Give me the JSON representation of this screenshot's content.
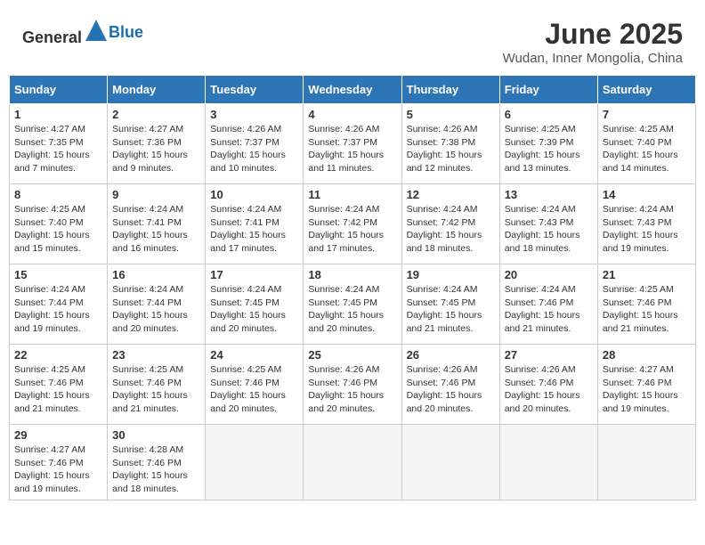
{
  "header": {
    "logo_general": "General",
    "logo_blue": "Blue",
    "month": "June 2025",
    "location": "Wudan, Inner Mongolia, China"
  },
  "days_of_week": [
    "Sunday",
    "Monday",
    "Tuesday",
    "Wednesday",
    "Thursday",
    "Friday",
    "Saturday"
  ],
  "weeks": [
    [
      {
        "day": "1",
        "info": "Sunrise: 4:27 AM\nSunset: 7:35 PM\nDaylight: 15 hours\nand 7 minutes."
      },
      {
        "day": "2",
        "info": "Sunrise: 4:27 AM\nSunset: 7:36 PM\nDaylight: 15 hours\nand 9 minutes."
      },
      {
        "day": "3",
        "info": "Sunrise: 4:26 AM\nSunset: 7:37 PM\nDaylight: 15 hours\nand 10 minutes."
      },
      {
        "day": "4",
        "info": "Sunrise: 4:26 AM\nSunset: 7:37 PM\nDaylight: 15 hours\nand 11 minutes."
      },
      {
        "day": "5",
        "info": "Sunrise: 4:26 AM\nSunset: 7:38 PM\nDaylight: 15 hours\nand 12 minutes."
      },
      {
        "day": "6",
        "info": "Sunrise: 4:25 AM\nSunset: 7:39 PM\nDaylight: 15 hours\nand 13 minutes."
      },
      {
        "day": "7",
        "info": "Sunrise: 4:25 AM\nSunset: 7:40 PM\nDaylight: 15 hours\nand 14 minutes."
      }
    ],
    [
      {
        "day": "8",
        "info": "Sunrise: 4:25 AM\nSunset: 7:40 PM\nDaylight: 15 hours\nand 15 minutes."
      },
      {
        "day": "9",
        "info": "Sunrise: 4:24 AM\nSunset: 7:41 PM\nDaylight: 15 hours\nand 16 minutes."
      },
      {
        "day": "10",
        "info": "Sunrise: 4:24 AM\nSunset: 7:41 PM\nDaylight: 15 hours\nand 17 minutes."
      },
      {
        "day": "11",
        "info": "Sunrise: 4:24 AM\nSunset: 7:42 PM\nDaylight: 15 hours\nand 17 minutes."
      },
      {
        "day": "12",
        "info": "Sunrise: 4:24 AM\nSunset: 7:42 PM\nDaylight: 15 hours\nand 18 minutes."
      },
      {
        "day": "13",
        "info": "Sunrise: 4:24 AM\nSunset: 7:43 PM\nDaylight: 15 hours\nand 18 minutes."
      },
      {
        "day": "14",
        "info": "Sunrise: 4:24 AM\nSunset: 7:43 PM\nDaylight: 15 hours\nand 19 minutes."
      }
    ],
    [
      {
        "day": "15",
        "info": "Sunrise: 4:24 AM\nSunset: 7:44 PM\nDaylight: 15 hours\nand 19 minutes."
      },
      {
        "day": "16",
        "info": "Sunrise: 4:24 AM\nSunset: 7:44 PM\nDaylight: 15 hours\nand 20 minutes."
      },
      {
        "day": "17",
        "info": "Sunrise: 4:24 AM\nSunset: 7:45 PM\nDaylight: 15 hours\nand 20 minutes."
      },
      {
        "day": "18",
        "info": "Sunrise: 4:24 AM\nSunset: 7:45 PM\nDaylight: 15 hours\nand 20 minutes."
      },
      {
        "day": "19",
        "info": "Sunrise: 4:24 AM\nSunset: 7:45 PM\nDaylight: 15 hours\nand 21 minutes."
      },
      {
        "day": "20",
        "info": "Sunrise: 4:24 AM\nSunset: 7:46 PM\nDaylight: 15 hours\nand 21 minutes."
      },
      {
        "day": "21",
        "info": "Sunrise: 4:25 AM\nSunset: 7:46 PM\nDaylight: 15 hours\nand 21 minutes."
      }
    ],
    [
      {
        "day": "22",
        "info": "Sunrise: 4:25 AM\nSunset: 7:46 PM\nDaylight: 15 hours\nand 21 minutes."
      },
      {
        "day": "23",
        "info": "Sunrise: 4:25 AM\nSunset: 7:46 PM\nDaylight: 15 hours\nand 21 minutes."
      },
      {
        "day": "24",
        "info": "Sunrise: 4:25 AM\nSunset: 7:46 PM\nDaylight: 15 hours\nand 20 minutes."
      },
      {
        "day": "25",
        "info": "Sunrise: 4:26 AM\nSunset: 7:46 PM\nDaylight: 15 hours\nand 20 minutes."
      },
      {
        "day": "26",
        "info": "Sunrise: 4:26 AM\nSunset: 7:46 PM\nDaylight: 15 hours\nand 20 minutes."
      },
      {
        "day": "27",
        "info": "Sunrise: 4:26 AM\nSunset: 7:46 PM\nDaylight: 15 hours\nand 20 minutes."
      },
      {
        "day": "28",
        "info": "Sunrise: 4:27 AM\nSunset: 7:46 PM\nDaylight: 15 hours\nand 19 minutes."
      }
    ],
    [
      {
        "day": "29",
        "info": "Sunrise: 4:27 AM\nSunset: 7:46 PM\nDaylight: 15 hours\nand 19 minutes."
      },
      {
        "day": "30",
        "info": "Sunrise: 4:28 AM\nSunset: 7:46 PM\nDaylight: 15 hours\nand 18 minutes."
      },
      {
        "day": "",
        "info": ""
      },
      {
        "day": "",
        "info": ""
      },
      {
        "day": "",
        "info": ""
      },
      {
        "day": "",
        "info": ""
      },
      {
        "day": "",
        "info": ""
      }
    ]
  ]
}
